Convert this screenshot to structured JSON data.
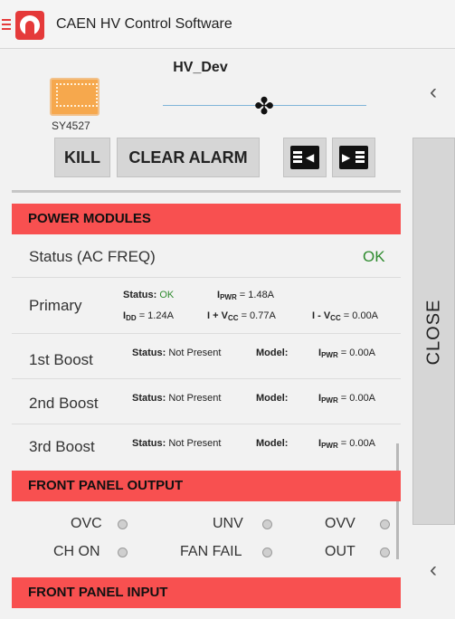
{
  "app": {
    "title": "CAEN HV Control Software"
  },
  "device": {
    "name": "HV_Dev",
    "model": "SY4527"
  },
  "icons": {
    "menu": "hamburger-icon",
    "logo": "caen-logo-icon",
    "fan": "fan-icon",
    "crate": "crate-icon",
    "back": "chevron-left-icon",
    "collapse": "collapse-left-icon",
    "expand": "expand-right-icon"
  },
  "toolbar": {
    "kill": "KILL",
    "clear_alarm": "CLEAR ALARM",
    "close": "CLOSE"
  },
  "power_modules": {
    "header": "POWER MODULES",
    "status_label": "Status (AC FREQ)",
    "status_value": "OK",
    "primary": {
      "label": "Primary",
      "status_key": "Status:",
      "status_val": "OK",
      "ipwr_key": "I",
      "ipwr_sub": "PWR",
      "ipwr_val": "= 1.48A",
      "idd_key": "I",
      "idd_sub": "DD",
      "idd_val": "= 1.24A",
      "ivccp_key": "I + V",
      "ivccp_sub": "CC",
      "ivccp_val": "= 0.77A",
      "ivccm_key": "I - V",
      "ivccm_sub": "CC",
      "ivccm_val": "= 0.00A"
    },
    "boosts": [
      {
        "label": "1st Boost",
        "status_key": "Status:",
        "status_val": "Not Present",
        "model_key": "Model:",
        "ipwr_key": "I",
        "ipwr_sub": "PWR",
        "ipwr_val": "= 0.00A"
      },
      {
        "label": "2nd Boost",
        "status_key": "Status:",
        "status_val": "Not Present",
        "model_key": "Model:",
        "ipwr_key": "I",
        "ipwr_sub": "PWR",
        "ipwr_val": "= 0.00A"
      },
      {
        "label": "3rd Boost",
        "status_key": "Status:",
        "status_val": "Not Present",
        "model_key": "Model:",
        "ipwr_key": "I",
        "ipwr_sub": "PWR",
        "ipwr_val": "= 0.00A"
      }
    ]
  },
  "front_panel_output": {
    "header": "FRONT PANEL OUTPUT",
    "leds": [
      "OVC",
      "UNV",
      "OVV",
      "CH ON",
      "FAN FAIL",
      "OUT"
    ]
  },
  "front_panel_input": {
    "header": "FRONT PANEL INPUT"
  }
}
